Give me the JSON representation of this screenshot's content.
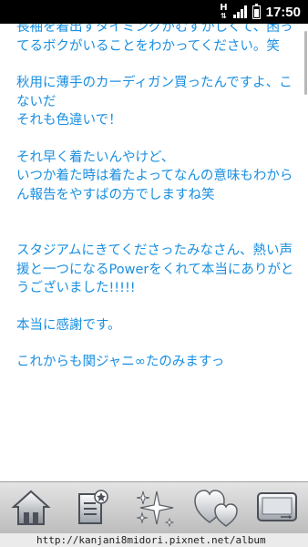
{
  "status_bar": {
    "network": "H",
    "time": "17:50"
  },
  "content": {
    "paragraphs": [
      "長袖を着出すタイミングがむずかしくて、困ってるボクがいることをわかってください。笑",
      "秋用に薄手のカーディガン買ったんですよ、こないだ",
      "それも色違いで！",
      "それ早く着たいんやけど、",
      "いつか着た時は着たよってなんの意味もわからん報告をやすばの方でしますね笑",
      "スタジアムにきてくださったみなさん、熱い声援と一つになるPowerをくれて本当にありがとうございました!!!!!",
      "本当に感謝です。",
      "これからも関ジャニ∞たのみますっ"
    ],
    "text_color": "#1a8fe0"
  },
  "toolbar": {
    "buttons": [
      "home-icon",
      "bookmark-icon",
      "sparkle-icon",
      "hearts-icon",
      "screen-icon"
    ]
  },
  "url_bar": {
    "url": "http://kanjani8midori.pixnet.net/album"
  }
}
